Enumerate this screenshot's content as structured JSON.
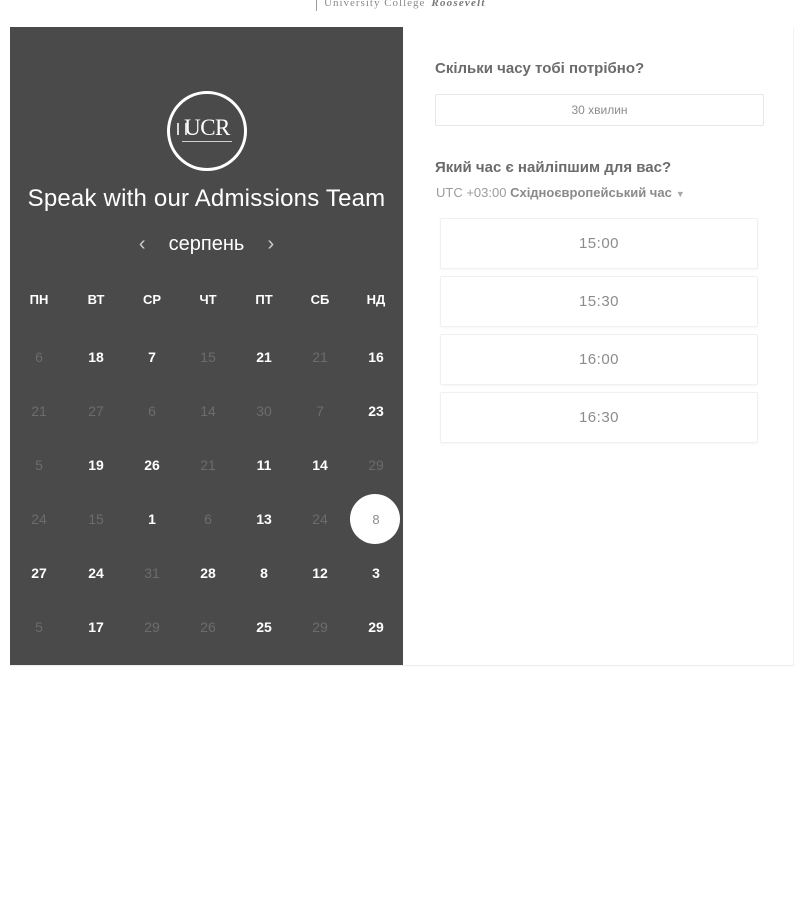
{
  "header": {
    "brand_left": "University College",
    "brand_right": "Roosevelt"
  },
  "calendar": {
    "logo_text": "UCR",
    "headline": "Speak with our Admissions Team",
    "month": "серпень",
    "prev_icon": "chevron-left",
    "next_icon": "chevron-right",
    "weekdays": [
      "ПН",
      "ВТ",
      "СР",
      "ЧТ",
      "ПТ",
      "СБ",
      "НД"
    ],
    "weeks": [
      [
        {
          "d": "6",
          "m": true
        },
        {
          "d": "18"
        },
        {
          "d": "7"
        },
        {
          "d": "15",
          "m": true
        },
        {
          "d": "21"
        },
        {
          "d": "21",
          "m": true
        },
        {
          "d": "16"
        }
      ],
      [
        {
          "d": "21",
          "m": true
        },
        {
          "d": "27",
          "m": true
        },
        {
          "d": "6",
          "m": true
        },
        {
          "d": "14",
          "m": true
        },
        {
          "d": "30",
          "m": true
        },
        {
          "d": "7",
          "m": true
        },
        {
          "d": "23"
        }
      ],
      [
        {
          "d": "5",
          "m": true
        },
        {
          "d": "19"
        },
        {
          "d": "26"
        },
        {
          "d": "21",
          "m": true
        },
        {
          "d": "11"
        },
        {
          "d": "14"
        },
        {
          "d": "29",
          "m": true
        }
      ],
      [
        {
          "d": "24",
          "m": true
        },
        {
          "d": "15",
          "m": true
        },
        {
          "d": "1"
        },
        {
          "d": "6",
          "m": true
        },
        {
          "d": "13"
        },
        {
          "d": "24",
          "m": true
        },
        {
          "d": "8",
          "s": true
        }
      ],
      [
        {
          "d": "27"
        },
        {
          "d": "24"
        },
        {
          "d": "31",
          "m": true
        },
        {
          "d": "28"
        },
        {
          "d": "8"
        },
        {
          "d": "12"
        },
        {
          "d": "3"
        }
      ],
      [
        {
          "d": "5",
          "m": true
        },
        {
          "d": "17"
        },
        {
          "d": "29",
          "m": true
        },
        {
          "d": "26",
          "m": true
        },
        {
          "d": "25"
        },
        {
          "d": "29",
          "m": true
        },
        {
          "d": "29"
        }
      ]
    ]
  },
  "booking": {
    "duration_question": "Скільки часу тобі потрібно?",
    "duration_value": "30 хвилин",
    "time_question": "Який час є найліпшим для вас?",
    "tz_offset": "UTC +03:00",
    "tz_name": "Східноєвропейський час",
    "slots": [
      "15:00",
      "15:30",
      "16:00",
      "16:30"
    ]
  },
  "colors": {
    "panel_bg": "#4a4a4a",
    "muted_day": "#6c6c6c",
    "text_gray": "#6b6b6b"
  }
}
